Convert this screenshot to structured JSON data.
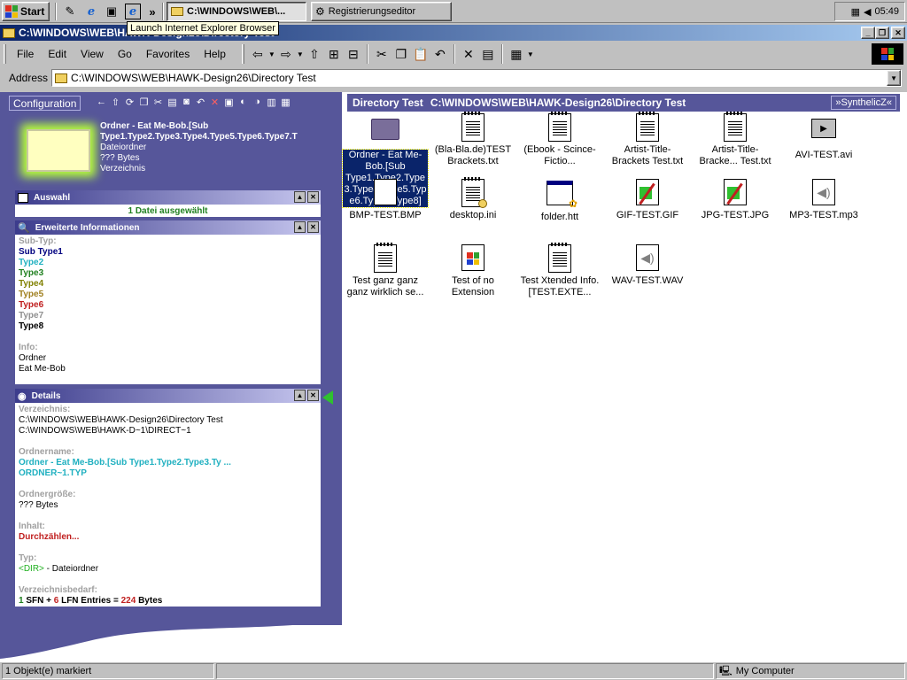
{
  "taskbar": {
    "start_label": "Start",
    "chevron": "»",
    "tasks": [
      {
        "label": "C:\\WINDOWS\\WEB\\...",
        "active": true
      },
      {
        "label": "Registrierungseditor",
        "active": false
      }
    ],
    "clock": "05:49",
    "tooltip": "Launch Internet Explorer Browser"
  },
  "window": {
    "title": "C:\\WINDOWS\\WEB\\HAWK-Design26\\Directory Test",
    "title_buttons": {
      "min": "_",
      "max": "❐",
      "close": "✕"
    }
  },
  "menu": {
    "items": [
      "File",
      "Edit",
      "View",
      "Go",
      "Favorites",
      "Help"
    ]
  },
  "address": {
    "label": "Address",
    "value": "C:\\WINDOWS\\WEB\\HAWK-Design26\\Directory Test"
  },
  "leftpane": {
    "config_label": "Configuration",
    "selection": {
      "name": "Ordner - Eat Me-Bob.[Sub Type1.Type2.Type3.Type4.Type5.Type6.Type7.T",
      "type": "Dateiordner",
      "size": "??? Bytes",
      "kind": "Verzeichnis"
    },
    "auswahl": {
      "title": "Auswahl",
      "value": "1 Datei ausgewählt"
    },
    "erweitert": {
      "title": "Erweiterte Informationen",
      "subtype_label": "Sub-Typ:",
      "types": [
        {
          "label": "Sub Type1",
          "color": "#000080"
        },
        {
          "label": "Type2",
          "color": "#20b0c0"
        },
        {
          "label": "Type3",
          "color": "#208020"
        },
        {
          "label": "Type4",
          "color": "#808000"
        },
        {
          "label": "Type5",
          "color": "#a08020"
        },
        {
          "label": "Type6",
          "color": "#c02020"
        },
        {
          "label": "Type7",
          "color": "#909090"
        },
        {
          "label": "Type8",
          "color": "#000000"
        }
      ],
      "info_label": "Info:",
      "info_lines": [
        "Ordner",
        "Eat Me-Bob"
      ]
    },
    "details": {
      "title": "Details",
      "verz_label": "Verzeichnis:",
      "verz_lines": [
        "C:\\WINDOWS\\WEB\\HAWK-Design26\\Directory Test",
        "C:\\WINDOWS\\WEB\\HAWK-D~1\\DIRECT~1"
      ],
      "ordnername_label": "Ordnername:",
      "ordnername_lines": [
        "Ordner - Eat Me-Bob.[Sub Type1.Type2.Type3.Ty ...",
        "ORDNER~1.TYP"
      ],
      "groesse_label": "Ordnergröße:",
      "groesse_value": "??? Bytes",
      "inhalt_label": "Inhalt:",
      "inhalt_value": "Durchzählen...",
      "typ_label": "Typ:",
      "typ_tag": "<DIR>",
      "typ_rest": " - Dateiordner",
      "bedarf_label": "Verzeichnisbedarf:",
      "bedarf_parts": {
        "sfn_n": "1",
        "sfn": " SFN + ",
        "lfn_n": "6",
        "lfn": " LFN Entries = ",
        "bytes_n": "224",
        "bytes": " Bytes"
      }
    }
  },
  "rightpane": {
    "path_left": "Directory Test",
    "path_right": "C:\\WINDOWS\\WEB\\HAWK-Design26\\Directory Test",
    "synth_label": "»SynthelicZ«",
    "files": [
      {
        "name": "Ordner - Eat Me-Bob.[Sub Type1.Type2.Type3.Type4.Type5.Type6.Type7.Type8]",
        "icon": "folder-icon",
        "selected": true
      },
      {
        "name": "(Bla-Bla.de)TEST Brackets.txt",
        "icon": "text-document-icon"
      },
      {
        "name": "(Ebook - Scince-Fictio...",
        "icon": "text-document-icon"
      },
      {
        "name": "Artist-Title-Brackets Test.txt",
        "icon": "text-document-icon"
      },
      {
        "name": "Artist-Title-Bracke... Test.txt",
        "icon": "text-document-icon"
      },
      {
        "name": "AVI-TEST.avi",
        "icon": "video-clip-icon"
      },
      {
        "name": "BMP-TEST.BMP",
        "icon": "bitmap-icon"
      },
      {
        "name": "desktop.ini",
        "icon": "settings-file-icon"
      },
      {
        "name": "folder.htt",
        "icon": "htt-template-icon"
      },
      {
        "name": "GIF-TEST.GIF",
        "icon": "image-icon"
      },
      {
        "name": "JPG-TEST.JPG",
        "icon": "image-icon"
      },
      {
        "name": "MP3-TEST.mp3",
        "icon": "audio-icon"
      },
      {
        "name": "Test ganz ganz ganz wirklich se...",
        "icon": "text-document-icon"
      },
      {
        "name": "Test of no Extension",
        "icon": "unknown-file-icon"
      },
      {
        "name": "Test Xtended Info.[TEST.EXTE...",
        "icon": "text-document-icon"
      },
      {
        "name": "WAV-TEST.WAV",
        "icon": "audio-icon"
      }
    ]
  },
  "status": {
    "left": "1 Objekt(e) markiert",
    "right": "My Computer"
  }
}
